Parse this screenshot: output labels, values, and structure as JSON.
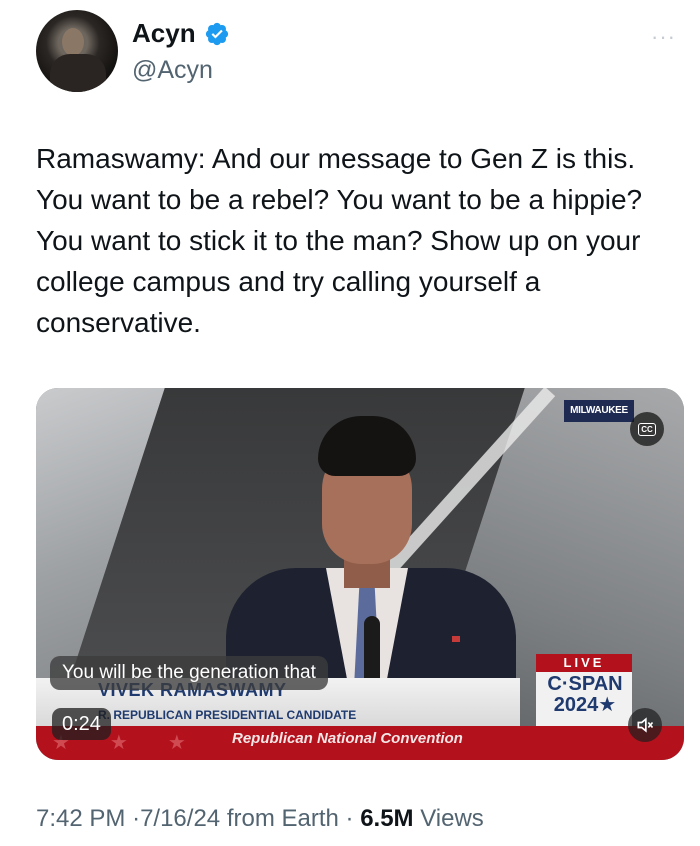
{
  "author": {
    "name": "Acyn",
    "handle": "@Acyn",
    "verified": true,
    "verified_color": "#1d9bf0"
  },
  "more_icon": "···",
  "tweet": {
    "text": "Ramaswamy: And our message to Gen Z is this. You want to be a rebel? You want to be a hippie? You want to stick it to the man? Show up on your college campus and try calling yourself a conservative."
  },
  "video": {
    "location_badge": "MILWAUKEE",
    "cc_label": "CC",
    "caption": "You will be the generation that",
    "duration": "0:24",
    "lower_third": {
      "name": "VIVEK RAMASWAMY",
      "title": "R. REPUBLICAN PRESIDENTIAL CANDIDATE",
      "event": "Republican National Convention"
    },
    "network": {
      "live": "LIVE",
      "line1": "C·SPAN",
      "line2": "2024★"
    },
    "mute_icon": "speaker-muted-icon"
  },
  "meta": {
    "time": "7:42 PM",
    "separator": "·",
    "date": "7/16/24",
    "source": "from Earth",
    "views_count": "6.5M",
    "views_label": "Views"
  },
  "colors": {
    "text": "#0f1419",
    "secondary": "#536471",
    "cspan_red": "#b3121d"
  }
}
